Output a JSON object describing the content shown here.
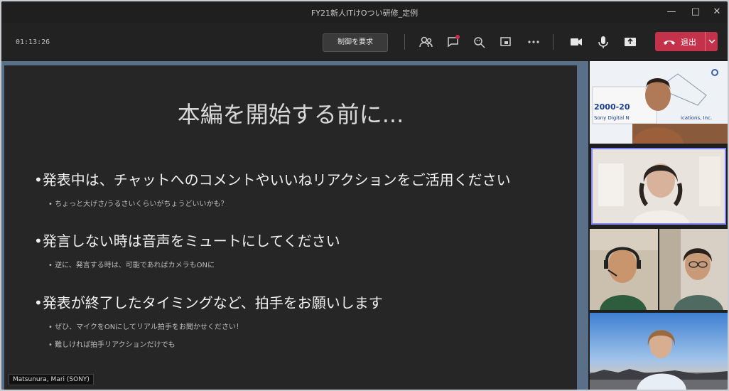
{
  "window": {
    "title": "FY21新人ITけOつい研修_定例",
    "minimize_icon": "minimize-icon",
    "maximize_icon": "maximize-icon",
    "close_icon": "close-icon"
  },
  "toolbar": {
    "timer": "01:13:26",
    "request_control_label": "制御を要求",
    "icons": [
      "people-icon",
      "chat-icon",
      "reactions-icon",
      "share-tray-icon",
      "more-icon",
      "camera-icon",
      "mic-icon",
      "share-screen-icon"
    ],
    "leave_label": "退出",
    "leave_color": "#c4314b"
  },
  "slide": {
    "title": "本編を開始する前に...",
    "bullets": [
      {
        "text": "•発表中は、チャットへのコメントやいいねリアクションをご活用ください",
        "subs": [
          "•  ちょっと大げさ/うるさいくらいがちょうどいいかも？"
        ]
      },
      {
        "text": "•発言しない時は音声をミュートにしてください",
        "subs": [
          "•  逆に、発言する時は、可能であればカメラもONに"
        ]
      },
      {
        "text": "•発表が終了したタイミングなど、拍手をお願いします",
        "subs": [
          "•  ぜひ、マイクをONにしてリアル拍手をお聞かせください！",
          "•  難しければ拍手リアクションだけでも"
        ]
      }
    ]
  },
  "presenter_name": "Matsunura, Mari (SONY)",
  "participants": {
    "banner_lines": [
      "2000-20",
      "Sony Digital N",
      "ications, Inc."
    ]
  }
}
